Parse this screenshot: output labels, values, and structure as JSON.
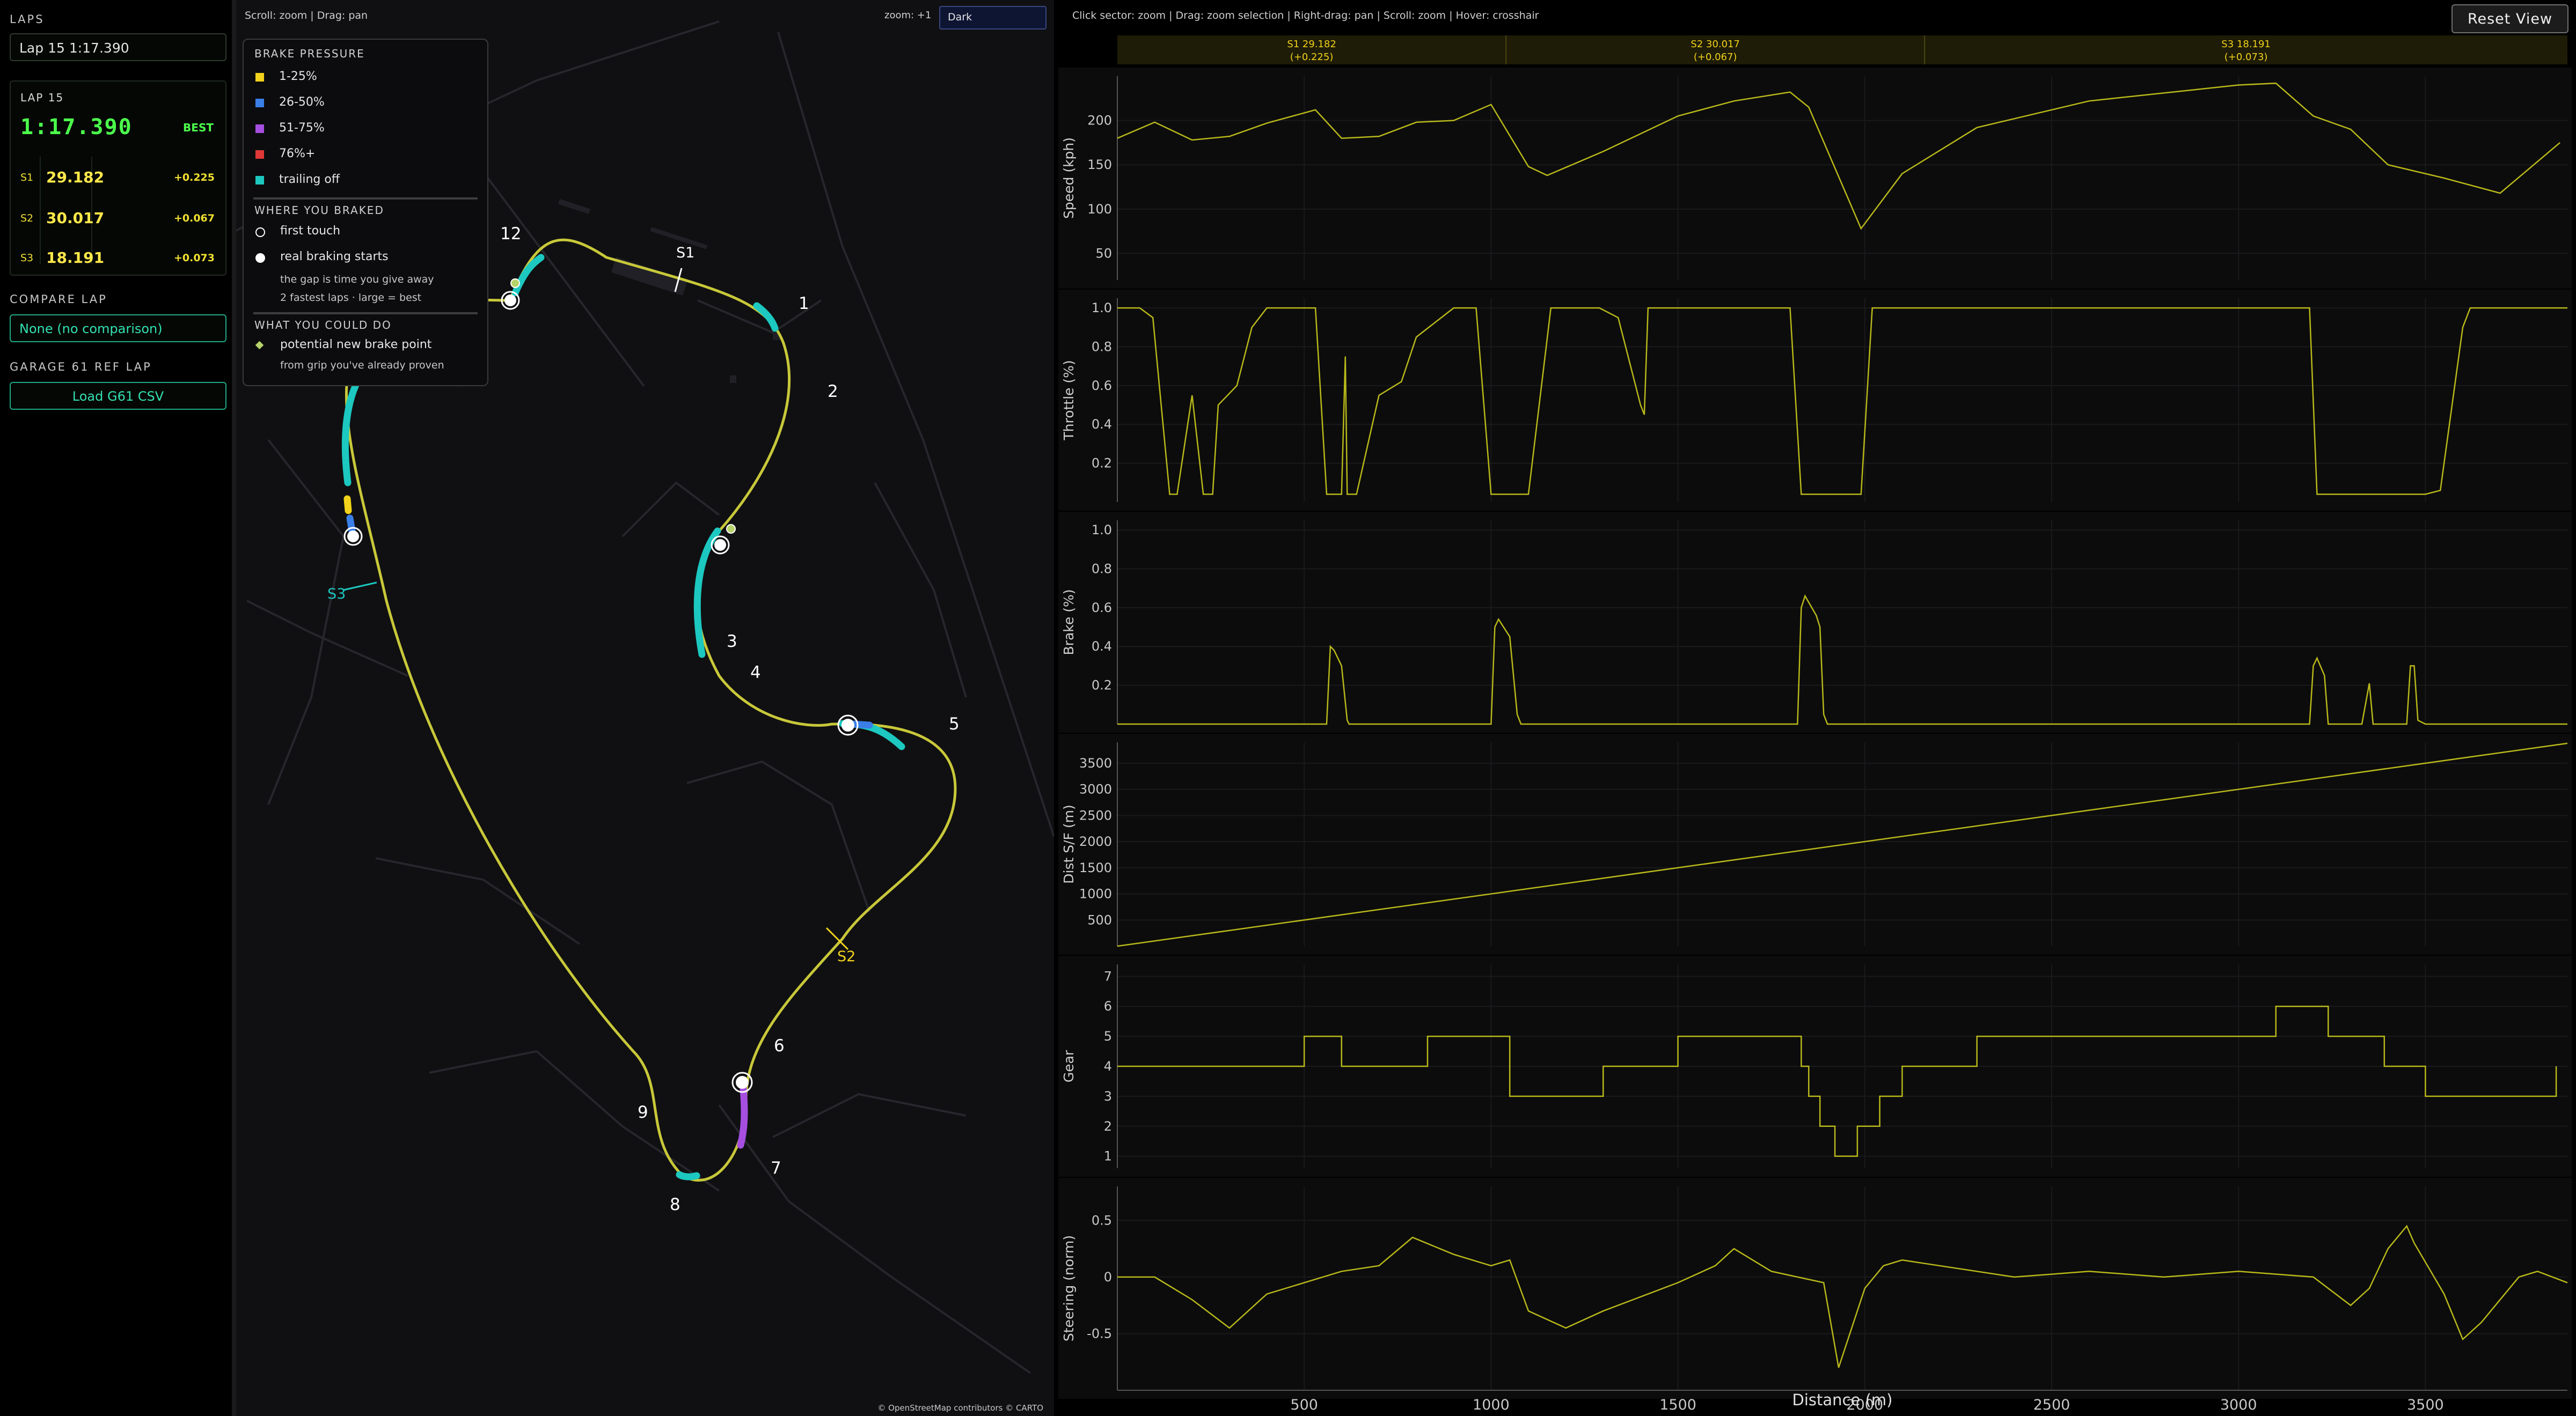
{
  "sidebar": {
    "laps_title": "LAPS",
    "lap_select": "Lap 15  1:17.390",
    "lap_card": {
      "name": "LAP 15",
      "time": "1:17.390",
      "badge": "BEST",
      "sectors": [
        {
          "label": "S1",
          "time": "29.182",
          "delta": "+0.225"
        },
        {
          "label": "S2",
          "time": "30.017",
          "delta": "+0.067"
        },
        {
          "label": "S3",
          "time": "18.191",
          "delta": "+0.073"
        }
      ]
    },
    "compare_title": "COMPARE LAP",
    "compare_value": "None  (no comparison)",
    "garage_title": "GARAGE 61 REF LAP",
    "load_button": "Load G61 CSV"
  },
  "map": {
    "hint": "Scroll: zoom  |  Drag: pan",
    "zoom_label": "zoom: +1",
    "theme_value": "Dark",
    "attribution": "© OpenStreetMap contributors © CARTO",
    "legend": {
      "brake_title": "BRAKE PRESSURE",
      "brake_items": [
        {
          "label": "1-25%",
          "color": "#f2d21b"
        },
        {
          "label": "26-50%",
          "color": "#3a7ee8"
        },
        {
          "label": "51-75%",
          "color": "#a64ee0"
        },
        {
          "label": "76%+",
          "color": "#e03838"
        },
        {
          "label": "trailing off",
          "color": "#1cc8c0"
        }
      ],
      "where_title": "WHERE YOU BRAKED",
      "first_touch": "first touch",
      "real_braking": "real braking starts",
      "gap_note": "the gap is time you give away",
      "fastest_note": "2 fastest laps · large = best",
      "could_title": "WHAT YOU COULD DO",
      "potential": "potential new brake point",
      "grip_note": "from grip you've already proven"
    },
    "corners": [
      "1",
      "2",
      "3",
      "4",
      "5",
      "6",
      "7",
      "8",
      "9",
      "12"
    ],
    "sector_labels": [
      "S1",
      "S2",
      "S3"
    ]
  },
  "telemetry": {
    "hint": "Click sector: zoom  |  Drag: zoom selection  |  Right-drag: pan  |  Scroll: zoom  |  Hover: crosshair",
    "reset_button": "Reset View",
    "sector_bar": [
      {
        "label": "S1  29.182",
        "delta": "(+0.225)"
      },
      {
        "label": "S2  30.017",
        "delta": "(+0.067)"
      },
      {
        "label": "S3  18.191",
        "delta": "(+0.073)"
      }
    ],
    "xlabel": "Distance (m)",
    "xticks": [
      "500",
      "1000",
      "1500",
      "2000",
      "2500",
      "3000",
      "3500"
    ],
    "line_color": "#b8b81a"
  },
  "chart_data": [
    {
      "type": "line",
      "ylabel": "Speed (kph)",
      "yticks": [
        "50",
        "100",
        "150",
        "200"
      ],
      "ylim": [
        20,
        250
      ],
      "x": [
        0,
        100,
        200,
        300,
        400,
        530,
        600,
        700,
        800,
        900,
        1000,
        1100,
        1150,
        1300,
        1500,
        1650,
        1800,
        1850,
        1990,
        2100,
        2300,
        2600,
        3000,
        3100,
        3200,
        3300,
        3400,
        3550,
        3700,
        3860
      ],
      "y": [
        180,
        198,
        178,
        182,
        197,
        212,
        180,
        182,
        198,
        200,
        218,
        148,
        138,
        165,
        205,
        222,
        232,
        215,
        78,
        140,
        192,
        222,
        240,
        242,
        205,
        190,
        150,
        135,
        118,
        175
      ]
    },
    {
      "type": "line",
      "ylabel": "Throttle (%)",
      "yticks": [
        "0.2",
        "0.4",
        "0.6",
        "0.8",
        "1.0"
      ],
      "ylim": [
        0,
        1.05
      ],
      "x": [
        0,
        60,
        95,
        140,
        160,
        200,
        230,
        255,
        270,
        320,
        360,
        400,
        530,
        560,
        600,
        610,
        615,
        640,
        700,
        760,
        800,
        900,
        960,
        1000,
        1060,
        1100,
        1160,
        1290,
        1340,
        1400,
        1410,
        1420,
        1490,
        1520,
        1600,
        1800,
        1830,
        1870,
        1920,
        1990,
        2020,
        3190,
        3210,
        3300,
        3400,
        3480,
        3500,
        3540,
        3600,
        3620,
        3640,
        3880
      ],
      "y": [
        1.0,
        1.0,
        0.95,
        0.04,
        0.04,
        0.55,
        0.04,
        0.04,
        0.5,
        0.6,
        0.9,
        1.0,
        1.0,
        0.04,
        0.04,
        0.75,
        0.04,
        0.04,
        0.55,
        0.62,
        0.85,
        1.0,
        1.0,
        0.04,
        0.04,
        0.04,
        1.0,
        1.0,
        0.95,
        0.5,
        0.45,
        1.0,
        1.0,
        1.0,
        1.0,
        1.0,
        0.04,
        0.04,
        0.04,
        0.04,
        1.0,
        1.0,
        0.04,
        0.04,
        0.04,
        0.04,
        0.04,
        0.06,
        0.9,
        1.0,
        1.0,
        1.0
      ]
    },
    {
      "type": "line",
      "ylabel": "Brake (%)",
      "yticks": [
        "0.2",
        "0.4",
        "0.6",
        "0.8",
        "1.0"
      ],
      "ylim": [
        0,
        1.05
      ],
      "x": [
        0,
        560,
        570,
        580,
        600,
        615,
        620,
        1000,
        1010,
        1020,
        1050,
        1070,
        1080,
        1820,
        1830,
        1840,
        1870,
        1880,
        1890,
        1900,
        3190,
        3200,
        3210,
        3230,
        3240,
        3330,
        3350,
        3360,
        3450,
        3460,
        3470,
        3480,
        3500,
        3880
      ],
      "y": [
        0,
        0,
        0.4,
        0.38,
        0.3,
        0.02,
        0,
        0,
        0.5,
        0.54,
        0.45,
        0.05,
        0,
        0,
        0.6,
        0.66,
        0.56,
        0.5,
        0.05,
        0,
        0,
        0.3,
        0.34,
        0.25,
        0,
        0,
        0.21,
        0,
        0,
        0.3,
        0.3,
        0.02,
        0,
        0
      ]
    },
    {
      "type": "line",
      "ylabel": "Dist S/F (m)",
      "yticks": [
        "500",
        "1000",
        "1500",
        "2000",
        "2500",
        "3000",
        "3500"
      ],
      "ylim": [
        0,
        3900
      ],
      "x": [
        0,
        3880
      ],
      "y": [
        0,
        3880
      ]
    },
    {
      "type": "line",
      "ylabel": "Gear",
      "yticks": [
        "1",
        "2",
        "3",
        "4",
        "5",
        "6",
        "7"
      ],
      "ylim": [
        0.6,
        7.4
      ],
      "x": [
        0,
        500,
        500,
        600,
        600,
        830,
        830,
        1050,
        1050,
        1300,
        1300,
        1500,
        1500,
        1830,
        1830,
        1850,
        1850,
        1880,
        1880,
        1920,
        1920,
        1980,
        1980,
        2040,
        2040,
        2100,
        2100,
        2300,
        2300,
        2600,
        2600,
        3100,
        3100,
        3240,
        3240,
        3390,
        3390,
        3500,
        3500,
        3600,
        3600,
        3850,
        3850
      ],
      "y": [
        4,
        4,
        5,
        5,
        4,
        4,
        5,
        5,
        3,
        3,
        4,
        4,
        5,
        5,
        4,
        4,
        3,
        3,
        2,
        2,
        1,
        1,
        2,
        2,
        3,
        3,
        4,
        4,
        5,
        5,
        5,
        5,
        6,
        6,
        5,
        5,
        4,
        4,
        3,
        3,
        3,
        3,
        4
      ]
    },
    {
      "type": "line",
      "ylabel": "Steering (norm)",
      "yticks": [
        "-0.5",
        "0",
        "0.5"
      ],
      "ylim": [
        -1.0,
        0.8
      ],
      "x": [
        0,
        100,
        200,
        300,
        400,
        600,
        700,
        790,
        900,
        1000,
        1050,
        1100,
        1200,
        1300,
        1500,
        1600,
        1650,
        1750,
        1890,
        1930,
        2000,
        2050,
        2100,
        2200,
        2400,
        2600,
        2800,
        3000,
        3200,
        3300,
        3350,
        3400,
        3450,
        3470,
        3550,
        3600,
        3650,
        3700,
        3750,
        3800,
        3880
      ],
      "y": [
        0,
        0,
        -0.2,
        -0.45,
        -0.15,
        0.05,
        0.1,
        0.35,
        0.2,
        0.1,
        0.15,
        -0.3,
        -0.45,
        -0.3,
        -0.05,
        0.1,
        0.25,
        0.05,
        -0.05,
        -0.8,
        -0.1,
        0.1,
        0.15,
        0.1,
        0.0,
        0.05,
        0.0,
        0.05,
        0.0,
        -0.25,
        -0.1,
        0.25,
        0.45,
        0.3,
        -0.15,
        -0.55,
        -0.4,
        -0.2,
        0.0,
        0.05,
        -0.05
      ]
    }
  ]
}
